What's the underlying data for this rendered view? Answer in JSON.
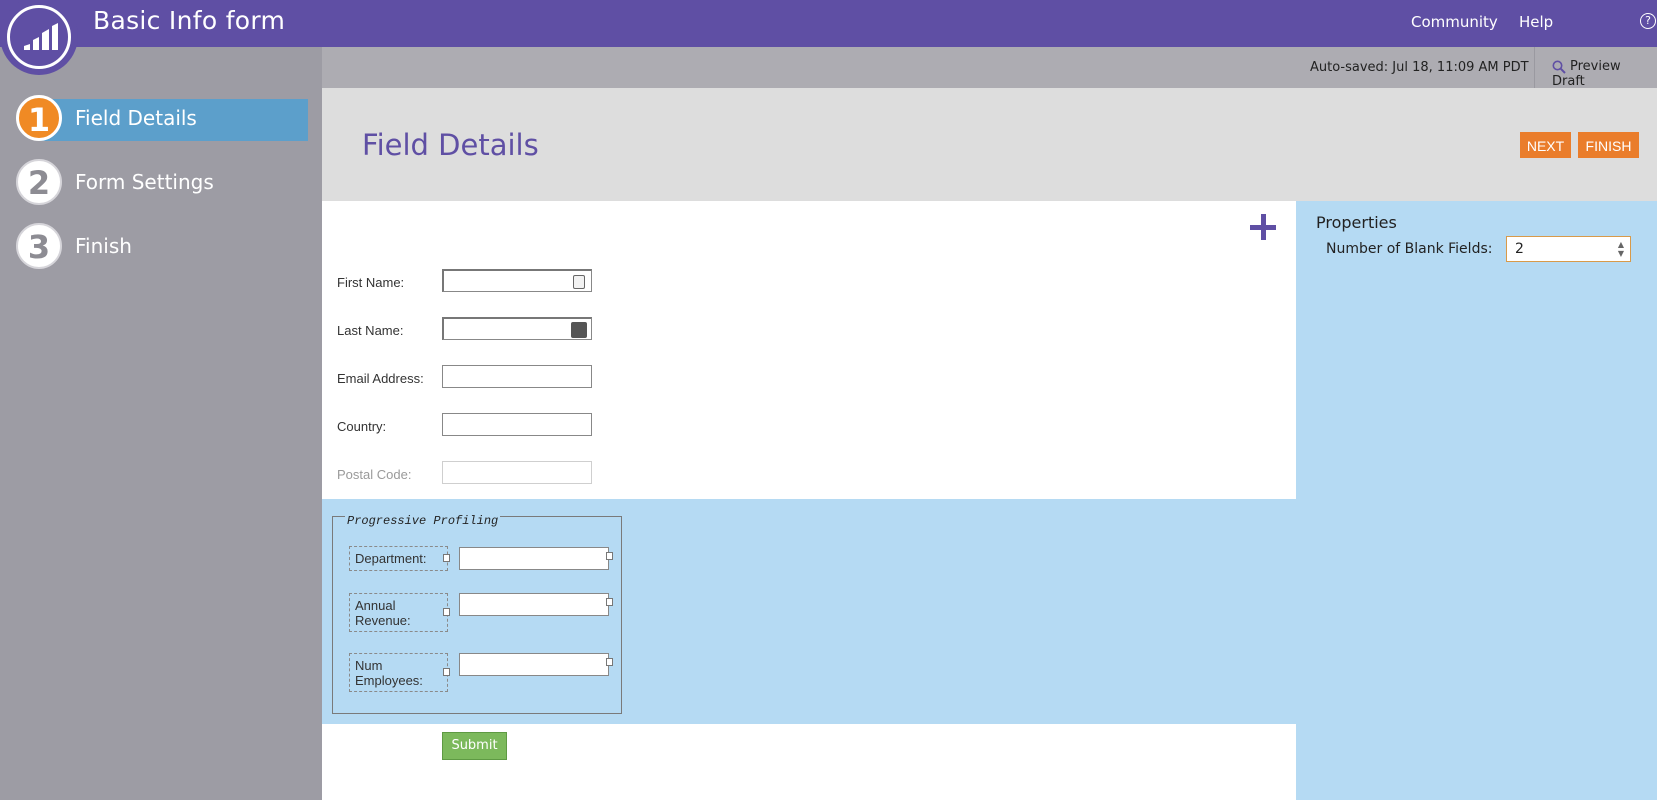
{
  "app": {
    "title": "Basic Info form",
    "nav": {
      "community": "Community",
      "help": "Help"
    },
    "help_icon_glyph": "?"
  },
  "sidebar": {
    "steps": [
      {
        "number": "1",
        "label": "Field Details",
        "active": true
      },
      {
        "number": "2",
        "label": "Form Settings",
        "active": false
      },
      {
        "number": "3",
        "label": "Finish",
        "active": false
      }
    ]
  },
  "subheader": {
    "autosaved": "Auto-saved: Jul 18, 11:09 AM PDT",
    "preview_label": "Preview Draft"
  },
  "page": {
    "title": "Field Details",
    "next_label": "NEXT",
    "finish_label": "FINISH"
  },
  "form": {
    "fields": [
      {
        "label": "First Name:"
      },
      {
        "label": "Last Name:"
      },
      {
        "label": "Email Address:"
      },
      {
        "label": "Country:"
      },
      {
        "label": "Postal Code:"
      }
    ],
    "progressive_profiling": {
      "legend": "Progressive Profiling",
      "fields": [
        {
          "label": "Department:"
        },
        {
          "label": "Annual Revenue:"
        },
        {
          "label": "Num Employees:"
        }
      ]
    },
    "submit_label": "Submit"
  },
  "properties": {
    "title": "Properties",
    "blank_fields_label": "Number of Blank Fields:",
    "blank_fields_value": "2"
  },
  "colors": {
    "brand_purple": "#5f4fa4",
    "accent_orange": "#ea7d2b",
    "active_step_blue": "#5c9fcb",
    "panel_blue": "#b5daf3",
    "submit_green": "#7cb95c"
  }
}
